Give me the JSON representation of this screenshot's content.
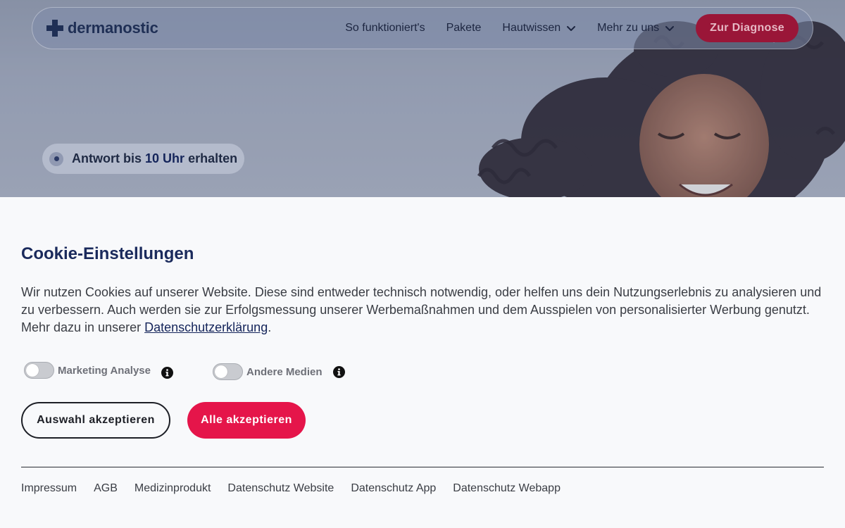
{
  "header": {
    "logo_text": "dermanostic",
    "nav": [
      {
        "label": "So funktioniert's",
        "has_dropdown": false
      },
      {
        "label": "Pakete",
        "has_dropdown": false
      },
      {
        "label": "Hautwissen",
        "has_dropdown": true
      },
      {
        "label": "Mehr zu uns",
        "has_dropdown": true
      }
    ],
    "cta_label": "Zur Diagnose"
  },
  "hero": {
    "badge_prefix": "Antwort bis",
    "badge_highlight": "10 Uhr",
    "badge_suffix": "erhalten"
  },
  "cookie": {
    "title": "Cookie-Einstellungen",
    "text": "Wir nutzen Cookies auf unserer Website. Diese sind entweder technisch notwendig, oder helfen uns dein Nutzungserlebnis zu analysieren und zu verbessern. Auch werden sie zur Erfolgsmessung unserer Werbemaßnahmen und dem Ausspielen von personalisierter Werbung genutzt. Mehr dazu in unserer",
    "link_label": "Datenschutzerklärung",
    "text_end": ".",
    "toggles": [
      {
        "label": "Marketing Analyse",
        "enabled": false
      },
      {
        "label": "Andere Medien",
        "enabled": false
      }
    ],
    "accept_selection_label": "Auswahl akzeptieren",
    "accept_all_label": "Alle akzeptieren"
  },
  "footer": {
    "links": [
      "Impressum",
      "AGB",
      "Medizinprodukt",
      "Datenschutz Website",
      "Datenschutz App",
      "Datenschutz Webapp"
    ]
  },
  "colors": {
    "brand_navy": "#1a2a5c",
    "cta_dark_red": "#9a1638",
    "accent_pink": "#e5154a"
  },
  "icons": [
    "logo-cross-icon",
    "chevron-down-icon",
    "info-icon"
  ]
}
